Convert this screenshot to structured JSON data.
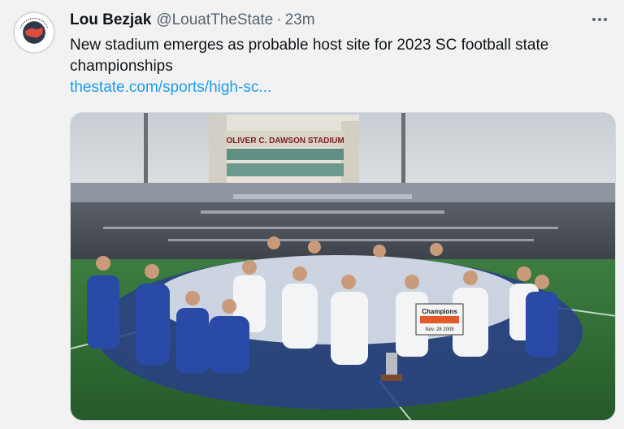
{
  "tweet": {
    "display_name": "Lou Bezjak",
    "handle": "@LouatTheState",
    "separator": "·",
    "time": "23m",
    "text": "New stadium emerges as probable host site for 2023 SC football state championships",
    "link_text": "thestate.com/sports/high-sc...",
    "avatar_icon": "the-state-news-guild-logo-icon",
    "more_icon": "more-options-icon"
  },
  "media": {
    "stadium_sign": "OLIVER C. DAWSON STADIUM",
    "banner_line1": "Champions",
    "banner_line2": "Nov. 28 2009"
  },
  "colors": {
    "link": "#1d9bf0",
    "secondary_text": "#536471",
    "team_blue": "#2a4aa8",
    "field_green": "#2f6e34"
  }
}
